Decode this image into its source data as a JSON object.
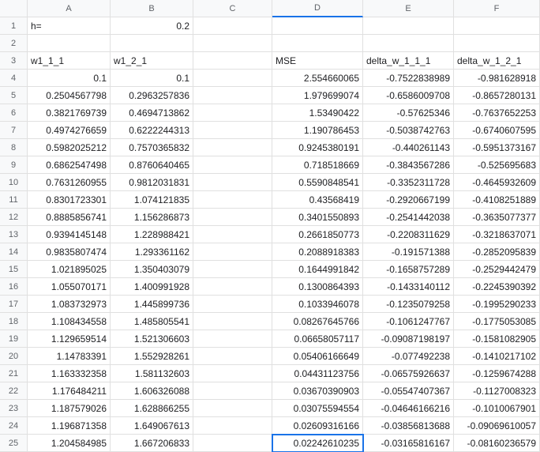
{
  "columns": [
    "A",
    "B",
    "C",
    "D",
    "E",
    "F"
  ],
  "rowCount": 25,
  "selectedCell": {
    "row": 25,
    "col": "D"
  },
  "selectedColumn": "D",
  "rows": [
    {
      "A": {
        "v": "h=",
        "t": "txt"
      },
      "B": {
        "v": "0.2",
        "t": "num"
      },
      "C": {
        "v": "",
        "t": "txt"
      },
      "D": {
        "v": "",
        "t": "txt"
      },
      "E": {
        "v": "",
        "t": "txt"
      },
      "F": {
        "v": "",
        "t": "txt"
      }
    },
    {
      "A": {
        "v": "",
        "t": "txt"
      },
      "B": {
        "v": "",
        "t": "txt"
      },
      "C": {
        "v": "",
        "t": "txt"
      },
      "D": {
        "v": "",
        "t": "txt"
      },
      "E": {
        "v": "",
        "t": "txt"
      },
      "F": {
        "v": "",
        "t": "txt"
      }
    },
    {
      "A": {
        "v": "w1_1_1",
        "t": "txt"
      },
      "B": {
        "v": "w1_2_1",
        "t": "txt"
      },
      "C": {
        "v": "",
        "t": "txt"
      },
      "D": {
        "v": "MSE",
        "t": "txt"
      },
      "E": {
        "v": "delta_w_1_1_1",
        "t": "txt"
      },
      "F": {
        "v": "delta_w_1_2_1",
        "t": "txt"
      }
    },
    {
      "A": {
        "v": "0.1",
        "t": "num"
      },
      "B": {
        "v": "0.1",
        "t": "num"
      },
      "C": {
        "v": "",
        "t": "txt"
      },
      "D": {
        "v": "2.554660065",
        "t": "num"
      },
      "E": {
        "v": "-0.7522838989",
        "t": "num"
      },
      "F": {
        "v": "-0.981628918",
        "t": "num"
      }
    },
    {
      "A": {
        "v": "0.2504567798",
        "t": "num"
      },
      "B": {
        "v": "0.2963257836",
        "t": "num"
      },
      "C": {
        "v": "",
        "t": "txt"
      },
      "D": {
        "v": "1.979699074",
        "t": "num"
      },
      "E": {
        "v": "-0.6586009708",
        "t": "num"
      },
      "F": {
        "v": "-0.8657280131",
        "t": "num"
      }
    },
    {
      "A": {
        "v": "0.3821769739",
        "t": "num"
      },
      "B": {
        "v": "0.4694713862",
        "t": "num"
      },
      "C": {
        "v": "",
        "t": "txt"
      },
      "D": {
        "v": "1.53490422",
        "t": "num"
      },
      "E": {
        "v": "-0.57625346",
        "t": "num"
      },
      "F": {
        "v": "-0.7637652253",
        "t": "num"
      }
    },
    {
      "A": {
        "v": "0.4974276659",
        "t": "num"
      },
      "B": {
        "v": "0.6222244313",
        "t": "num"
      },
      "C": {
        "v": "",
        "t": "txt"
      },
      "D": {
        "v": "1.190786453",
        "t": "num"
      },
      "E": {
        "v": "-0.5038742763",
        "t": "num"
      },
      "F": {
        "v": "-0.6740607595",
        "t": "num"
      }
    },
    {
      "A": {
        "v": "0.5982025212",
        "t": "num"
      },
      "B": {
        "v": "0.7570365832",
        "t": "num"
      },
      "C": {
        "v": "",
        "t": "txt"
      },
      "D": {
        "v": "0.9245380191",
        "t": "num"
      },
      "E": {
        "v": "-0.440261143",
        "t": "num"
      },
      "F": {
        "v": "-0.5951373167",
        "t": "num"
      }
    },
    {
      "A": {
        "v": "0.6862547498",
        "t": "num"
      },
      "B": {
        "v": "0.8760640465",
        "t": "num"
      },
      "C": {
        "v": "",
        "t": "txt"
      },
      "D": {
        "v": "0.718518669",
        "t": "num"
      },
      "E": {
        "v": "-0.3843567286",
        "t": "num"
      },
      "F": {
        "v": "-0.525695683",
        "t": "num"
      }
    },
    {
      "A": {
        "v": "0.7631260955",
        "t": "num"
      },
      "B": {
        "v": "0.9812031831",
        "t": "num"
      },
      "C": {
        "v": "",
        "t": "txt"
      },
      "D": {
        "v": "0.5590848541",
        "t": "num"
      },
      "E": {
        "v": "-0.3352311728",
        "t": "num"
      },
      "F": {
        "v": "-0.4645932609",
        "t": "num"
      }
    },
    {
      "A": {
        "v": "0.8301723301",
        "t": "num"
      },
      "B": {
        "v": "1.074121835",
        "t": "num"
      },
      "C": {
        "v": "",
        "t": "txt"
      },
      "D": {
        "v": "0.43568419",
        "t": "num"
      },
      "E": {
        "v": "-0.2920667199",
        "t": "num"
      },
      "F": {
        "v": "-0.4108251889",
        "t": "num"
      }
    },
    {
      "A": {
        "v": "0.8885856741",
        "t": "num"
      },
      "B": {
        "v": "1.156286873",
        "t": "num"
      },
      "C": {
        "v": "",
        "t": "txt"
      },
      "D": {
        "v": "0.3401550893",
        "t": "num"
      },
      "E": {
        "v": "-0.2541442038",
        "t": "num"
      },
      "F": {
        "v": "-0.3635077377",
        "t": "num"
      }
    },
    {
      "A": {
        "v": "0.9394145148",
        "t": "num"
      },
      "B": {
        "v": "1.228988421",
        "t": "num"
      },
      "C": {
        "v": "",
        "t": "txt"
      },
      "D": {
        "v": "0.2661850773",
        "t": "num"
      },
      "E": {
        "v": "-0.2208311629",
        "t": "num"
      },
      "F": {
        "v": "-0.3218637071",
        "t": "num"
      }
    },
    {
      "A": {
        "v": "0.9835807474",
        "t": "num"
      },
      "B": {
        "v": "1.293361162",
        "t": "num"
      },
      "C": {
        "v": "",
        "t": "txt"
      },
      "D": {
        "v": "0.2088918383",
        "t": "num"
      },
      "E": {
        "v": "-0.191571388",
        "t": "num"
      },
      "F": {
        "v": "-0.2852095839",
        "t": "num"
      }
    },
    {
      "A": {
        "v": "1.021895025",
        "t": "num"
      },
      "B": {
        "v": "1.350403079",
        "t": "num"
      },
      "C": {
        "v": "",
        "t": "txt"
      },
      "D": {
        "v": "0.1644991842",
        "t": "num"
      },
      "E": {
        "v": "-0.1658757289",
        "t": "num"
      },
      "F": {
        "v": "-0.2529442479",
        "t": "num"
      }
    },
    {
      "A": {
        "v": "1.055070171",
        "t": "num"
      },
      "B": {
        "v": "1.400991928",
        "t": "num"
      },
      "C": {
        "v": "",
        "t": "txt"
      },
      "D": {
        "v": "0.1300864393",
        "t": "num"
      },
      "E": {
        "v": "-0.1433140112",
        "t": "num"
      },
      "F": {
        "v": "-0.2245390392",
        "t": "num"
      }
    },
    {
      "A": {
        "v": "1.083732973",
        "t": "num"
      },
      "B": {
        "v": "1.445899736",
        "t": "num"
      },
      "C": {
        "v": "",
        "t": "txt"
      },
      "D": {
        "v": "0.1033946078",
        "t": "num"
      },
      "E": {
        "v": "-0.1235079258",
        "t": "num"
      },
      "F": {
        "v": "-0.1995290233",
        "t": "num"
      }
    },
    {
      "A": {
        "v": "1.108434558",
        "t": "num"
      },
      "B": {
        "v": "1.485805541",
        "t": "num"
      },
      "C": {
        "v": "",
        "t": "txt"
      },
      "D": {
        "v": "0.08267645766",
        "t": "num"
      },
      "E": {
        "v": "-0.1061247767",
        "t": "num"
      },
      "F": {
        "v": "-0.1775053085",
        "t": "num"
      }
    },
    {
      "A": {
        "v": "1.129659514",
        "t": "num"
      },
      "B": {
        "v": "1.521306603",
        "t": "num"
      },
      "C": {
        "v": "",
        "t": "txt"
      },
      "D": {
        "v": "0.06658057117",
        "t": "num"
      },
      "E": {
        "v": "-0.09087198197",
        "t": "num"
      },
      "F": {
        "v": "-0.1581082905",
        "t": "num"
      }
    },
    {
      "A": {
        "v": "1.14783391",
        "t": "num"
      },
      "B": {
        "v": "1.552928261",
        "t": "num"
      },
      "C": {
        "v": "",
        "t": "txt"
      },
      "D": {
        "v": "0.05406166649",
        "t": "num"
      },
      "E": {
        "v": "-0.077492238",
        "t": "num"
      },
      "F": {
        "v": "-0.1410217102",
        "t": "num"
      }
    },
    {
      "A": {
        "v": "1.163332358",
        "t": "num"
      },
      "B": {
        "v": "1.581132603",
        "t": "num"
      },
      "C": {
        "v": "",
        "t": "txt"
      },
      "D": {
        "v": "0.04431123756",
        "t": "num"
      },
      "E": {
        "v": "-0.06575926637",
        "t": "num"
      },
      "F": {
        "v": "-0.1259674288",
        "t": "num"
      }
    },
    {
      "A": {
        "v": "1.176484211",
        "t": "num"
      },
      "B": {
        "v": "1.606326088",
        "t": "num"
      },
      "C": {
        "v": "",
        "t": "txt"
      },
      "D": {
        "v": "0.03670390903",
        "t": "num"
      },
      "E": {
        "v": "-0.05547407367",
        "t": "num"
      },
      "F": {
        "v": "-0.1127008323",
        "t": "num"
      }
    },
    {
      "A": {
        "v": "1.187579026",
        "t": "num"
      },
      "B": {
        "v": "1.628866255",
        "t": "num"
      },
      "C": {
        "v": "",
        "t": "txt"
      },
      "D": {
        "v": "0.03075594554",
        "t": "num"
      },
      "E": {
        "v": "-0.04646166216",
        "t": "num"
      },
      "F": {
        "v": "-0.1010067901",
        "t": "num"
      }
    },
    {
      "A": {
        "v": "1.196871358",
        "t": "num"
      },
      "B": {
        "v": "1.649067613",
        "t": "num"
      },
      "C": {
        "v": "",
        "t": "txt"
      },
      "D": {
        "v": "0.02609316166",
        "t": "num"
      },
      "E": {
        "v": "-0.03856813688",
        "t": "num"
      },
      "F": {
        "v": "-0.09069610057",
        "t": "num"
      }
    },
    {
      "A": {
        "v": "1.204584985",
        "t": "num"
      },
      "B": {
        "v": "1.667206833",
        "t": "num"
      },
      "C": {
        "v": "",
        "t": "txt"
      },
      "D": {
        "v": "0.02242610235",
        "t": "num"
      },
      "E": {
        "v": "-0.03165816167",
        "t": "num"
      },
      "F": {
        "v": "-0.08160236579",
        "t": "num"
      }
    }
  ]
}
